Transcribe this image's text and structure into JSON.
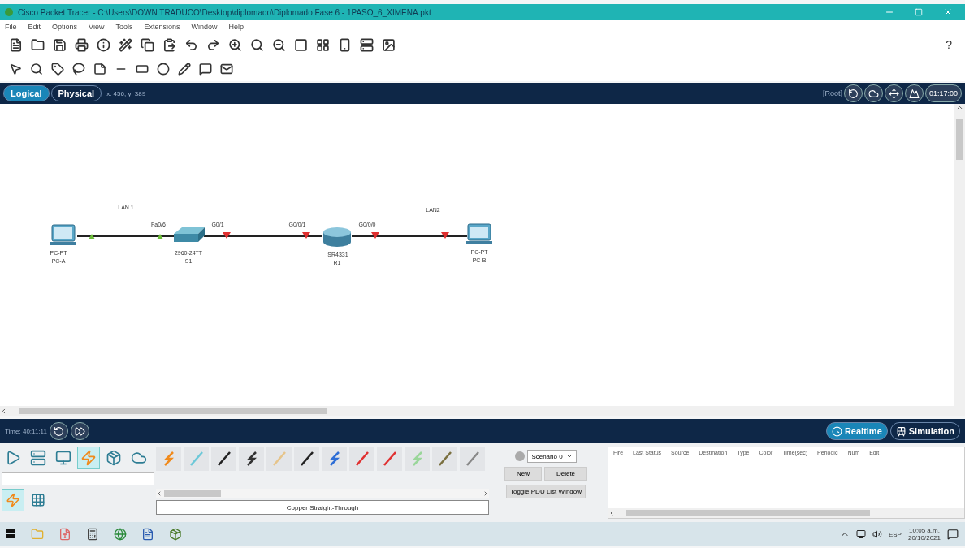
{
  "window": {
    "title": "Cisco Packet Tracer - C:\\Users\\DOWN TRADUCO\\Desktop\\diplomado\\Diplomado Fase 6 - 1PASO_6_XIMENA.pkt"
  },
  "menu": [
    "File",
    "Edit",
    "Options",
    "View",
    "Tools",
    "Extensions",
    "Window",
    "Help"
  ],
  "help_button": "?",
  "workspace_tabs": [
    {
      "label": "Logical",
      "selected": true
    },
    {
      "label": "Physical",
      "selected": false
    }
  ],
  "coordinates": "x: 456, y: 389",
  "root_label": "[Root]",
  "viewport_time": "01:17:00",
  "diagram": {
    "nodes": [
      {
        "kind": "pc",
        "model": "PC-PT",
        "name": "PC-A"
      },
      {
        "kind": "switch",
        "model": "2960-24TT",
        "name": "S1"
      },
      {
        "kind": "router",
        "model": "ISR4331",
        "name": "R1"
      },
      {
        "kind": "pc",
        "model": "PC-PT",
        "name": "PC-B"
      }
    ],
    "labels": [
      "LAN 1",
      "Fa0/6",
      "G0/1",
      "G0/0/1",
      "G0/0/0",
      "LAN2"
    ],
    "ports": [
      {
        "up": true
      },
      {
        "up": true
      },
      {
        "up": false
      },
      {
        "up": false
      },
      {
        "up": false
      },
      {
        "up": false
      }
    ]
  },
  "time_bar": {
    "time": "Time: 40:11:11"
  },
  "modes": [
    {
      "label": "Realtime",
      "selected": true
    },
    {
      "label": "Simulation",
      "selected": false
    }
  ],
  "device_categories": [
    {
      "selected": false
    },
    {
      "selected": false
    },
    {
      "selected": false
    },
    {
      "selected": true
    },
    {
      "selected": false
    },
    {
      "selected": false
    }
  ],
  "subcategories": [
    {
      "selected": true
    },
    {
      "selected": false
    }
  ],
  "connection_caption": "Copper Straight-Through",
  "scenario": {
    "value": "Scenario 0",
    "new": "New",
    "delete": "Delete",
    "toggle": "Toggle PDU List Window"
  },
  "pdu_columns": [
    "Fire",
    "Last Status",
    "Source",
    "Destination",
    "Type",
    "Color",
    "Time(sec)",
    "Periodic",
    "Num",
    "Edit"
  ],
  "taskbar": {
    "language": "ESP",
    "time": "10:05 a.m.",
    "date": "20/10/2021"
  }
}
